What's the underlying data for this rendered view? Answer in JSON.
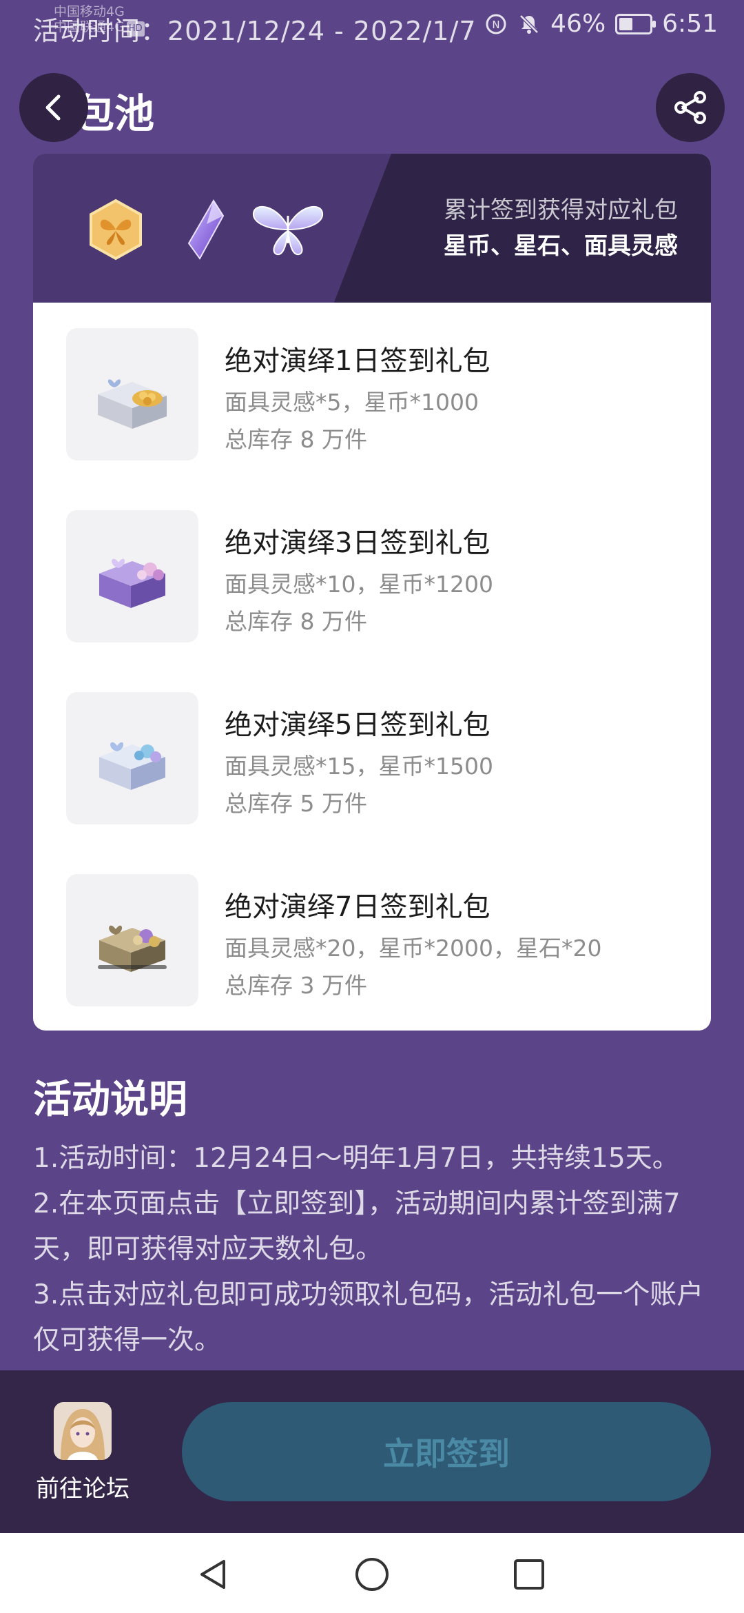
{
  "status_bar": {
    "activity_time_text": "活动时间：2021/12/24 - 2022/1/7",
    "carrier_line1": "中国移动4G",
    "carrier_line2": "中国联通4G",
    "hd_badge": "HD",
    "battery_text": "46%",
    "battery_level": 0.46,
    "time": "6:51"
  },
  "header": {
    "title": "礼包池",
    "back_icon": "chevron-left-icon",
    "share_icon": "share-icon"
  },
  "banner": {
    "subtitle": "累计签到获得对应礼包",
    "currencies": "星币、星石、面具灵感",
    "icons": [
      "butterfly-coin-icon",
      "crystal-icon",
      "butterfly-icon"
    ]
  },
  "packs": [
    {
      "title": "绝对演绎1日签到礼包",
      "content": "面具灵感*5，星币*1000",
      "stock": "总库存 8 万件"
    },
    {
      "title": "绝对演绎3日签到礼包",
      "content": "面具灵感*10，星币*1200",
      "stock": "总库存 8 万件"
    },
    {
      "title": "绝对演绎5日签到礼包",
      "content": "面具灵感*15，星币*1500",
      "stock": "总库存 5 万件"
    },
    {
      "title": "绝对演绎7日签到礼包",
      "content": "面具灵感*20，星币*2000，星石*20",
      "stock": "总库存 3 万件"
    }
  ],
  "description": {
    "title": "活动说明",
    "lines": [
      "1.活动时间：12月24日～明年1月7日，共持续15天。",
      "2.在本页面点击【立即签到】，活动期间内累计签到满7天，即可获得对应天数礼包。",
      "3.点击对应礼包即可成功领取礼包码，活动礼包一个账户仅可获得一次。"
    ]
  },
  "bottom": {
    "forum_label": "前往论坛",
    "signin_label": "立即签到"
  },
  "colors": {
    "background": "#5b4487",
    "banner_dark": "#2f2447",
    "button_disabled": "#2e5a76"
  }
}
